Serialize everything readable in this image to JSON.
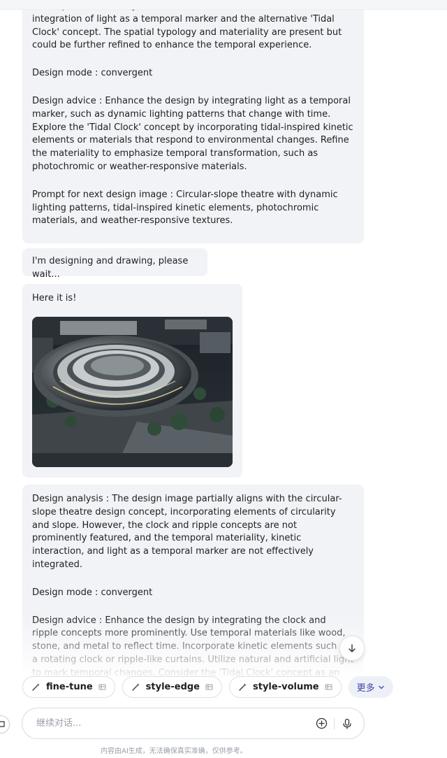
{
  "messages": [
    {
      "paragraphs": [
        "of temporal materiality and kinetic interaction, it lacks clear integration of light as a temporal marker and the alternative 'Tidal Clock' concept. The spatial typology and materiality are present but could be further refined to enhance the temporal experience.",
        "Design mode : convergent",
        "Design advice : Enhance the design by integrating light as a temporal marker, such as dynamic lighting patterns that change with time. Explore the 'Tidal Clock' concept by incorporating tidal-inspired kinetic elements or materials that respond to environmental changes. Refine the materiality to emphasize temporal transformation, such as photochromic or weather-responsive materials.",
        "Prompt for next design image : Circular-slope theatre with dynamic lighting patterns, tidal-inspired kinetic elements, photochromic materials, and weather-responsive textures."
      ]
    },
    {
      "text": "I'm designing and drawing, please wait..."
    },
    {
      "text": "Here it is!",
      "image": "aerial-render-circular-slope-theatre-at-night"
    },
    {
      "paragraphs": [
        "Design analysis : The design image partially aligns with the circular-slope theatre design concept, incorporating elements of circularity and slope. However, the clock and ripple concepts are not prominently featured, and the temporal materiality, kinetic interaction, and light as a temporal marker are not effectively integrated.",
        "Design mode : convergent",
        "Design advice : Enhance the design by integrating the clock and ripple concepts more prominently. Use temporal materials like wood, stone, and metal to reflect time. Incorporate kinetic elements such as a rotating clock or ripple-like curtains. Utilize natural and artificial light to mark temporal changes. Consider the 'Tidal Clock' concept as an alternative to further emphasize the theme of time and movement."
      ]
    }
  ],
  "chips": [
    {
      "label": "fine-tune",
      "icon": "sparkle-icon",
      "badge": "grid-icon"
    },
    {
      "label": "style-edge",
      "icon": "sparkle-icon",
      "badge": "grid-icon"
    },
    {
      "label": "style-volume",
      "icon": "sparkle-icon",
      "badge": "grid-icon"
    }
  ],
  "more_label": "更多",
  "composer": {
    "placeholder": "继续对话..."
  },
  "disclaimer": "内容由AI生成，无法确保真实准确，仅供参考。",
  "colors": {
    "bubble": "#f2f3f7",
    "accent": "#3b47a8",
    "border": "#dcdfe5",
    "muted": "#9aa0aa"
  }
}
